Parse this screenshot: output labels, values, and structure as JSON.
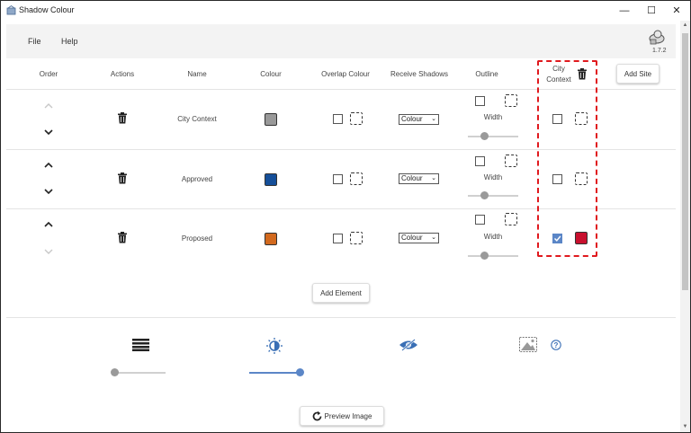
{
  "window": {
    "title": "Shadow Colour",
    "icon": "globe-app-icon",
    "minimize": "—",
    "maximize": "☐",
    "close": "✕"
  },
  "menu": {
    "items": [
      "File",
      "Help"
    ],
    "version": "1.7.2",
    "version_icon": "cloud-user-icon"
  },
  "table": {
    "headers": {
      "order": "Order",
      "actions": "Actions",
      "name": "Name",
      "colour": "Colour",
      "overlap": "Overlap Colour",
      "receive": "Receive Shadows",
      "outline": "Outline",
      "site_line1": "City",
      "site_line2": "Context"
    },
    "add_site_label": "Add Site",
    "width_label": "Width",
    "rows": [
      {
        "name": "City Context",
        "colour": "#999999",
        "receive": "Colour",
        "site_checked": false,
        "site_colour": null,
        "up_enabled": false,
        "down_enabled": true
      },
      {
        "name": "Approved",
        "colour": "#154f99",
        "receive": "Colour",
        "site_checked": false,
        "site_colour": null,
        "up_enabled": true,
        "down_enabled": true
      },
      {
        "name": "Proposed",
        "colour": "#d2691e",
        "receive": "Colour",
        "site_checked": true,
        "site_colour": "#c8102e",
        "up_enabled": true,
        "down_enabled": false
      }
    ],
    "add_element_label": "Add Element"
  },
  "tools": {
    "lines_icon": "lines-icon",
    "brightness_icon": "brightness-icon",
    "visibility_icon": "eye-off-icon",
    "image_icon": "image-icon",
    "help_icon": "help-icon",
    "lines_slider_value": 0,
    "brightness_slider_value": 1
  },
  "preview_label": "Preview Image",
  "colors": {
    "accent": "#5b86c7",
    "highlight": "#e0191e"
  }
}
